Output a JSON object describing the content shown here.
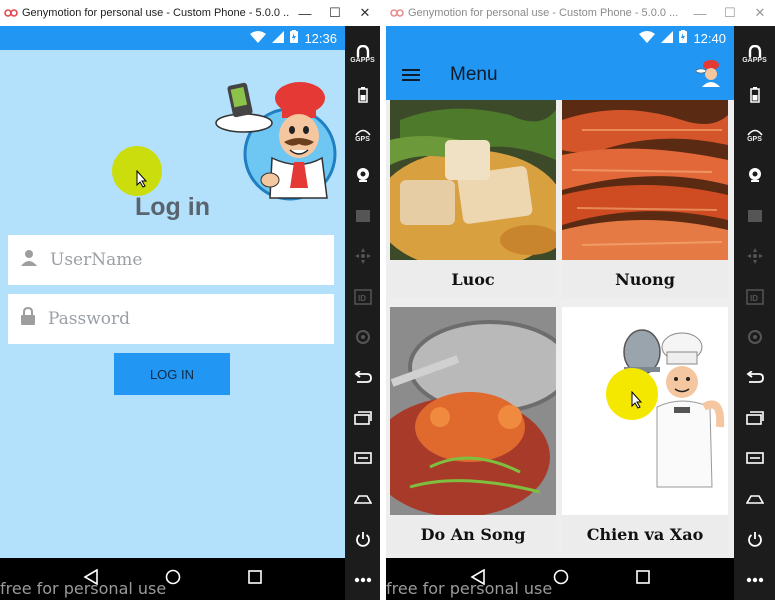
{
  "window1": {
    "title": "Genymotion for personal use - Custom Phone - 5.0.0 ...",
    "controls": [
      "minimize",
      "maximize",
      "close"
    ],
    "status": {
      "time": "12:36"
    },
    "login": {
      "title": "Log in",
      "username_placeholder": "UserName",
      "password_placeholder": "Password",
      "button": "LOG IN"
    },
    "watermark": "free for personal use"
  },
  "window2": {
    "title": "Genymotion for personal use - Custom Phone - 5.0.0 ...",
    "status": {
      "time": "12:40"
    },
    "appbar": {
      "title": "Menu"
    },
    "cards": [
      {
        "label": "Luoc"
      },
      {
        "label": "Nuong"
      },
      {
        "label": "Do An Song"
      },
      {
        "label": "Chien va Xao"
      }
    ],
    "watermark": "free for personal use"
  },
  "sidebar": {
    "items": [
      {
        "icon": "gapps-icon",
        "label": "GAPPS"
      },
      {
        "icon": "battery-icon",
        "label": ""
      },
      {
        "icon": "gps-icon",
        "label": "GPS"
      },
      {
        "icon": "webcam-icon",
        "label": ""
      },
      {
        "icon": "clapper-icon",
        "label": ""
      },
      {
        "icon": "dpad-icon",
        "label": ""
      },
      {
        "icon": "id-icon",
        "label": "ID"
      },
      {
        "icon": "phone-icon",
        "label": ""
      },
      {
        "icon": "back-icon",
        "label": ""
      },
      {
        "icon": "recents-icon",
        "label": ""
      },
      {
        "icon": "menu-icon",
        "label": ""
      },
      {
        "icon": "home-icon",
        "label": ""
      },
      {
        "icon": "power-icon",
        "label": ""
      },
      {
        "icon": "more-icon",
        "label": ""
      }
    ]
  },
  "colors": {
    "primary": "#2196F3",
    "login_bg": "#B3E1FB",
    "touch_green": "#CDDC00",
    "touch_yellow": "#F5E800"
  }
}
